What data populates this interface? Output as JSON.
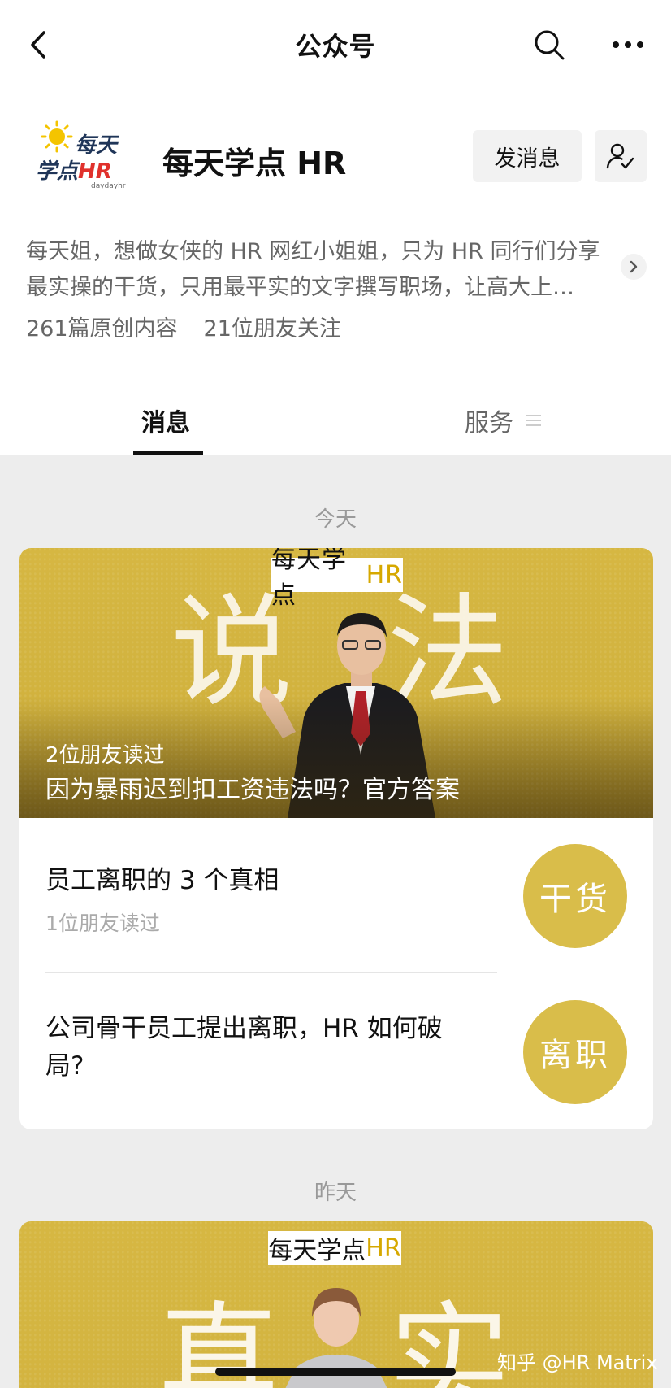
{
  "topbar": {
    "title": "公众号"
  },
  "account": {
    "logo_text_line1": "每天",
    "logo_text_line2": "学点HR",
    "logo_sub": "daydayhr",
    "name": "每天学点 HR",
    "message_button": "发消息",
    "description": "每天姐，想做女侠的 HR 网红小姐姐，只为 HR 同行们分享最实操的干货，只用最平实的文字撰写职场，让高大上…",
    "stat_articles": "261篇原创内容",
    "stat_friends": "21位朋友关注"
  },
  "tabs": {
    "messages": "消息",
    "services": "服务"
  },
  "feed": {
    "today_label": "今天",
    "yesterday_label": "昨天",
    "cover": {
      "brand_prefix": "每天学点",
      "brand_hr": "HR",
      "char_left": "说",
      "char_right": "法",
      "readers": "2位朋友读过",
      "headline": "因为暴雨迟到扣工资违法吗？官方答案"
    },
    "items": [
      {
        "title": "员工离职的 3 个真相",
        "sub": "1位朋友读过",
        "thumb_text": "干货"
      },
      {
        "title": "公司骨干员工提出离职，HR 如何破局?",
        "sub": "",
        "thumb_text": "离职"
      }
    ],
    "cover2": {
      "brand_prefix": "每天学点",
      "brand_hr": "HR",
      "char_left": "真",
      "char_right": "实"
    }
  },
  "watermark": "知乎 @HR Matrix",
  "colors": {
    "accent_yellow": "#d6b742",
    "background": "#ededed"
  }
}
